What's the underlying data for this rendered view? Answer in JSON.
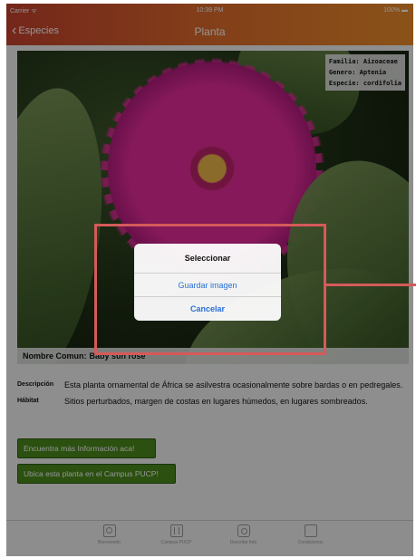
{
  "status_bar": {
    "carrier": "Carrier ᯤ",
    "time": "10:39 PM",
    "battery": "100% ▬"
  },
  "nav": {
    "back_label": "Especies",
    "title": "Planta"
  },
  "photo": {
    "taxonomy": {
      "familia": "Familia: Aizoaceae",
      "genero": "Genero: Aptenia",
      "especie": "Especie: cordifolia"
    },
    "common_name_label": "Nombre Comun:",
    "common_name_value": "Baby sun rose"
  },
  "details": {
    "descripcion_label": "Descripción",
    "descripcion_text": "Esta planta ornamental de África se asilvestra ocasionalmente sobre bardas o en pedregales.",
    "habitat_label": "Hábitat",
    "habitat_text": "Sitios perturbados, margen de costas en lugares húmedos, en lugares sombreados."
  },
  "buttons": {
    "more_info": "Encuentra más Información aca!",
    "locate": "Ubica esta planta en el Campus PUCP!"
  },
  "tab_bar": {
    "items": [
      {
        "label": "Bienvenido",
        "icon": "search-icon"
      },
      {
        "label": "Campus PUCP",
        "icon": "map-icon"
      },
      {
        "label": "Describe foto",
        "icon": "camera-icon"
      },
      {
        "label": "Contáctenos",
        "icon": "contact-icon"
      }
    ]
  },
  "dialog": {
    "title": "Seleccionar",
    "save_label": "Guardar imagen",
    "cancel_label": "Cancelar"
  },
  "colors": {
    "header_gradient_start": "#c8432f",
    "header_gradient_end": "#ee8f2c",
    "button_green": "#4a8a1c",
    "dialog_action_blue": "#2a6fd6",
    "highlight_red": "#d45a5a"
  }
}
